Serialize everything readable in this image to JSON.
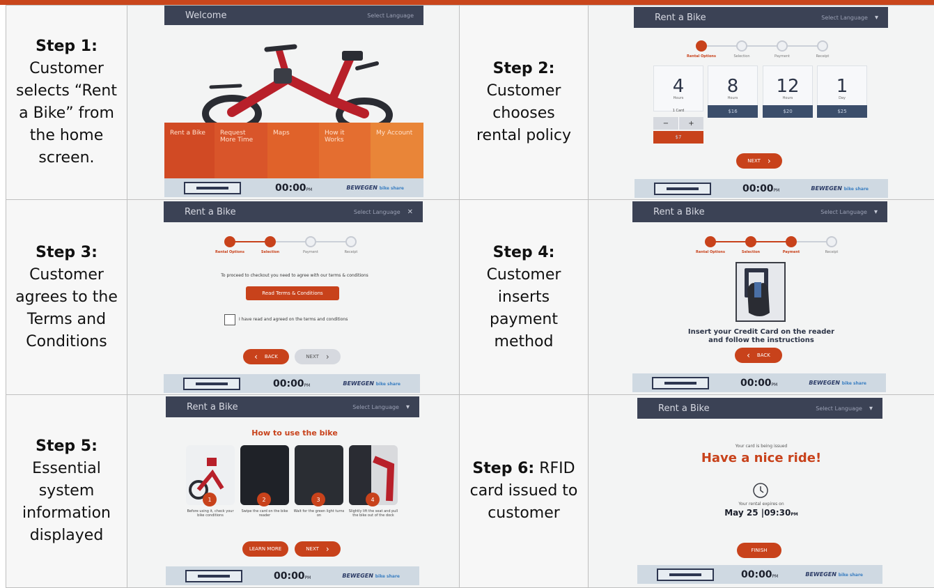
{
  "steps": [
    {
      "title": "Step 1:",
      "lines": [
        "Customer",
        "selects “Rent",
        "a Bike” from",
        "the home",
        "screen."
      ]
    },
    {
      "title": "Step 2:",
      "lines": [
        "Customer",
        "chooses",
        "rental policy"
      ]
    },
    {
      "title": "Step 3:",
      "lines": [
        "Customer",
        "agrees to the",
        "Terms and",
        "Conditions"
      ]
    },
    {
      "title": "Step 4:",
      "lines": [
        "Customer",
        "inserts",
        "payment",
        "method"
      ]
    },
    {
      "title": "Step 5:",
      "lines": [
        "Essential",
        "system",
        "information",
        "displayed"
      ]
    },
    {
      "title": "Step 6:",
      "inline_rest": "RFID",
      "lines": [
        "card issued to",
        "customer"
      ]
    }
  ],
  "kiosk": {
    "footer": {
      "clock": "00:00",
      "clock_suffix": "PM",
      "brand": "BEWEGEN",
      "brand_sub": "bike share"
    },
    "select_language": "Select Language",
    "screen1": {
      "header": "Welcome",
      "menu": [
        "Rent a Bike",
        "Request More Time",
        "Maps",
        "How it Works",
        "My Account"
      ]
    },
    "screen2": {
      "header": "Rent a Bike",
      "progress": [
        "Rental Options",
        "Selection",
        "Payment",
        "Receipt"
      ],
      "options": [
        {
          "num": "4",
          "unit": "Hours",
          "price": "$7"
        },
        {
          "num": "8",
          "unit": "Hours",
          "price": "$16"
        },
        {
          "num": "12",
          "unit": "Hours",
          "price": "$20"
        },
        {
          "num": "1",
          "unit": "Day",
          "price": "$25"
        }
      ],
      "card_label": "1 Card",
      "minus": "−",
      "plus": "+",
      "next": "NEXT"
    },
    "screen3": {
      "header": "Rent a Bike",
      "progress": [
        "Rental Options",
        "Selection",
        "Payment",
        "Receipt"
      ],
      "instruction": "To proceed to checkout you need to agree with our terms & conditions",
      "read_button": "Read Terms & Conditions",
      "checkbox_label": "I have read and agreed on the terms and conditions",
      "back": "BACK",
      "next": "NEXT"
    },
    "screen4": {
      "header": "Rent a Bike",
      "progress": [
        "Rental Options",
        "Selection",
        "Payment",
        "Receipt"
      ],
      "instruction_line1": "Insert your Credit Card on the reader",
      "instruction_line2": "and follow the instructions",
      "back": "BACK"
    },
    "screen5": {
      "header": "Rent a Bike",
      "title": "How to use the bike",
      "cards": [
        {
          "num": "1",
          "caption": "Before using it, check your bike conditions"
        },
        {
          "num": "2",
          "caption": "Swipe the card on the bike reader"
        },
        {
          "num": "3",
          "caption": "Wait for the green light turns on"
        },
        {
          "num": "4",
          "caption": "Slightly lift the seat and pull the bike out of the dock"
        }
      ],
      "learn_more": "LEARN MORE",
      "next": "NEXT"
    },
    "screen6": {
      "header": "Rent a Bike",
      "issuing": "Your card is being issued",
      "headline": "Have a nice ride!",
      "expires_label": "Your rental expires on",
      "expires_value": "May 25 |09:30",
      "expires_suffix": "PM",
      "finish": "FINISH"
    }
  },
  "colors": {
    "accent": "#c8421b",
    "header": "#3b4255",
    "footer": "#cfd9e2",
    "menu_orange": "#e0622a"
  }
}
